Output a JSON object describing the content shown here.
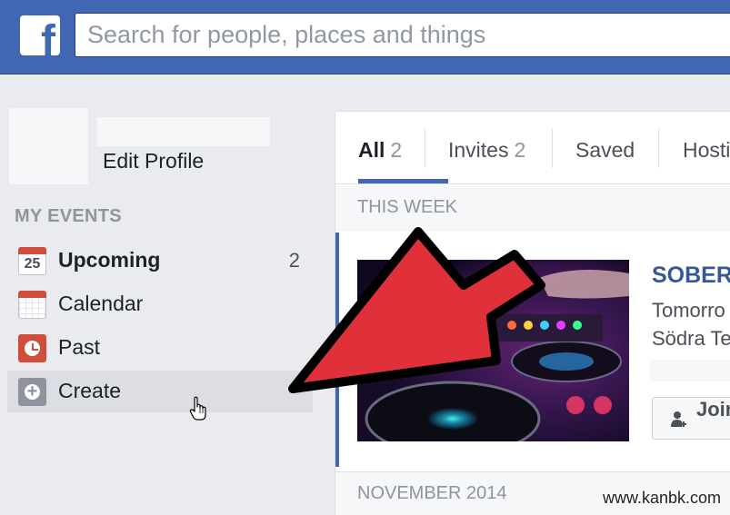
{
  "header": {
    "logo_letter": "f",
    "search_placeholder": "Search for people, places and things"
  },
  "profile": {
    "edit_label": "Edit Profile"
  },
  "sidebar": {
    "section_title": "MY EVENTS",
    "items": [
      {
        "label": "Upcoming",
        "count": "2",
        "icon": "date-icon",
        "icon_text": "25"
      },
      {
        "label": "Calendar",
        "icon": "calendar-icon"
      },
      {
        "label": "Past",
        "icon": "clock-icon"
      },
      {
        "label": "Create",
        "icon": "plus-icon",
        "icon_text": "+"
      }
    ]
  },
  "tabs": [
    {
      "label": "All",
      "count": "2"
    },
    {
      "label": "Invites",
      "count": "2"
    },
    {
      "label": "Saved"
    },
    {
      "label": "Hosti"
    }
  ],
  "sections": {
    "this_week": "THIS WEEK",
    "november": "NOVEMBER 2014"
  },
  "event": {
    "title": "SOBER",
    "when": "Tomorro",
    "where": "Södra Te",
    "join_label": "Join"
  },
  "watermark": "www.kanbk.com",
  "colors": {
    "brand_blue": "#4267b2",
    "arrow_red": "#e0313a",
    "link_blue": "#365899"
  }
}
